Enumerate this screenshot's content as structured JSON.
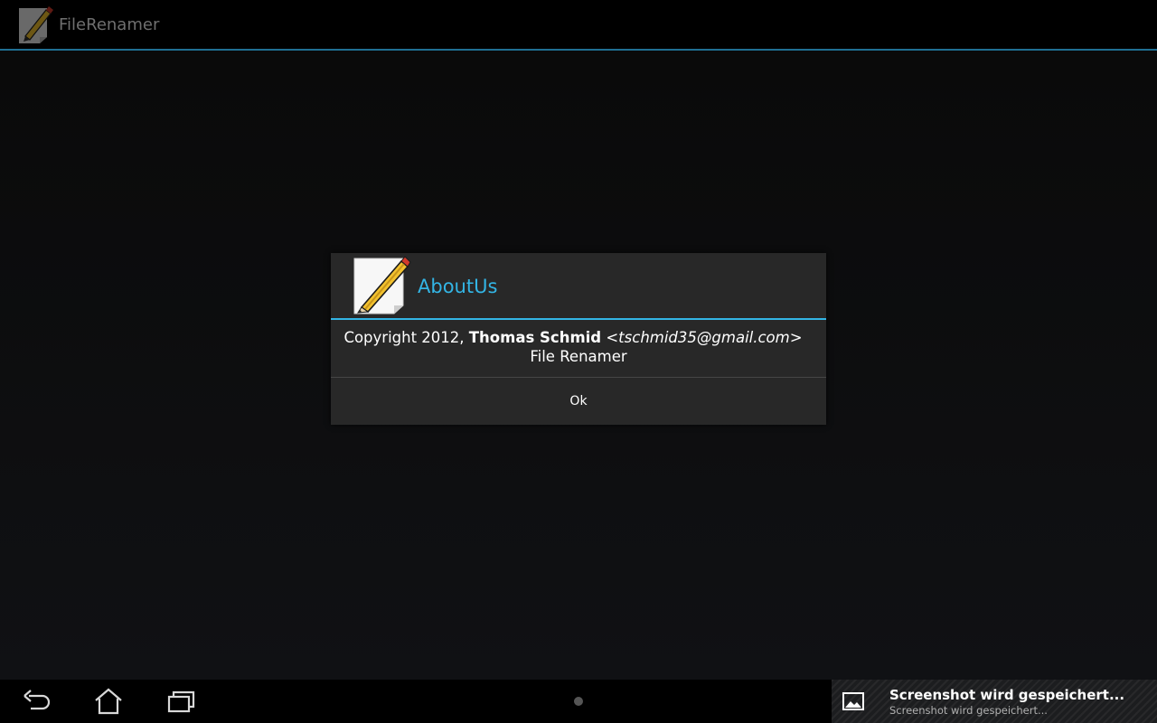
{
  "app": {
    "title": "FileRenamer",
    "icon": "pencil-note-icon"
  },
  "dialog": {
    "title": "AboutUs",
    "icon": "pencil-note-icon",
    "message": {
      "prefix": "Copyright 2012, ",
      "author": "Thomas Schmid",
      "email": "<tschmid35@gmail.com>",
      "line2": "File Renamer"
    },
    "ok_label": "Ok"
  },
  "navigation": {
    "back": "back-arrow-icon",
    "home": "home-icon",
    "recents": "recent-apps-icon"
  },
  "notification": {
    "icon": "image-icon",
    "title": "Screenshot wird gespeichert...",
    "subtitle": "Screenshot wird gespeichert..."
  },
  "colors": {
    "accent": "#33b5e5",
    "dialog_background": "#282828",
    "screen_background": "#000000"
  }
}
